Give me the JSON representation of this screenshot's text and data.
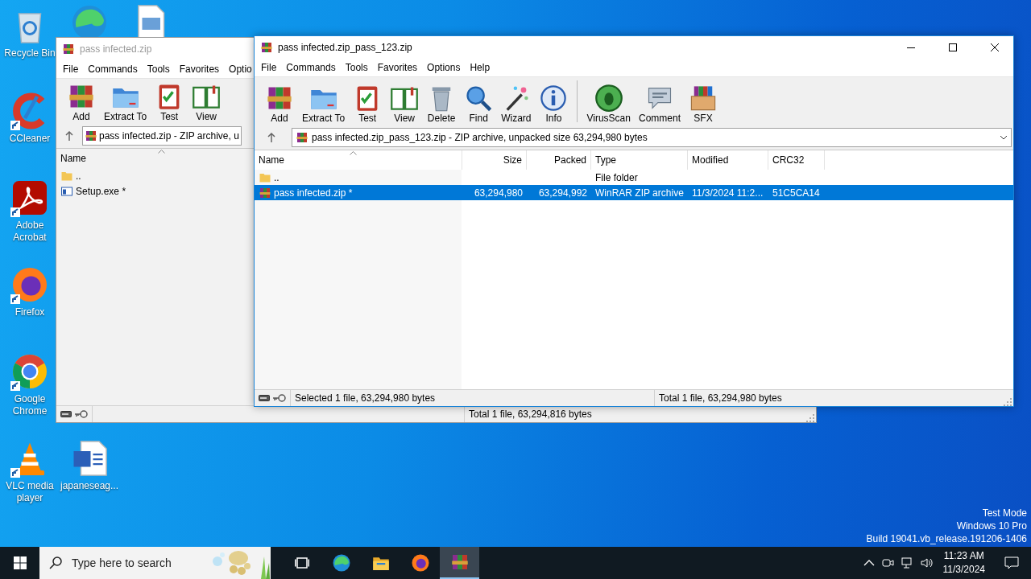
{
  "desktop_icons": [
    {
      "kind": "recycle",
      "label": "Recycle Bin",
      "shortcut": false
    },
    {
      "kind": "edge",
      "shortcut": false
    },
    {
      "kind": "image-file",
      "shortcut": false
    },
    {
      "kind": "ccleaner",
      "label": "CCleaner",
      "shortcut": true
    },
    {
      "kind": "acrobat",
      "label": "Adobe Acrobat",
      "shortcut": true
    },
    {
      "kind": "firefox",
      "label": "Firefox",
      "shortcut": true
    },
    {
      "kind": "chrome",
      "label": "Google Chrome",
      "shortcut": true
    },
    {
      "kind": "vlc",
      "label": "VLC media player",
      "shortcut": true
    },
    {
      "kind": "word",
      "label": "japaneseag...",
      "shortcut": false
    }
  ],
  "back_window": {
    "title": "pass infected.zip",
    "active": false,
    "menu": [
      "File",
      "Commands",
      "Tools",
      "Favorites",
      "Optio"
    ],
    "toolbar_groups": [
      [
        {
          "kind": "add",
          "label": "Add"
        },
        {
          "kind": "extract",
          "label": "Extract To"
        },
        {
          "kind": "test",
          "label": "Test"
        },
        {
          "kind": "view",
          "label": "View"
        }
      ]
    ],
    "address": "pass infected.zip - ZIP archive, u",
    "columns": [
      "Name"
    ],
    "rows": [
      {
        "kind": "up",
        "name": "..",
        "selected": false
      },
      {
        "kind": "exe",
        "name": "Setup.exe *",
        "selected": false
      }
    ],
    "status": [
      "Total 1 file, 63,294,816 bytes"
    ]
  },
  "front_window": {
    "title": "pass infected.zip_pass_123.zip",
    "active": true,
    "menu": [
      "File",
      "Commands",
      "Tools",
      "Favorites",
      "Options",
      "Help"
    ],
    "toolbar_groups": [
      [
        {
          "kind": "add",
          "label": "Add"
        },
        {
          "kind": "extract",
          "label": "Extract To"
        },
        {
          "kind": "test",
          "label": "Test"
        },
        {
          "kind": "view",
          "label": "View"
        },
        {
          "kind": "delete",
          "label": "Delete"
        },
        {
          "kind": "find",
          "label": "Find"
        },
        {
          "kind": "wizard",
          "label": "Wizard"
        },
        {
          "kind": "info",
          "label": "Info"
        }
      ],
      [
        {
          "kind": "virusscan",
          "label": "VirusScan"
        },
        {
          "kind": "comment",
          "label": "Comment"
        },
        {
          "kind": "sfx",
          "label": "SFX"
        }
      ]
    ],
    "address": "pass infected.zip_pass_123.zip - ZIP archive, unpacked size 63,294,980 bytes",
    "columns": [
      "Name",
      "Size",
      "Packed",
      "Type",
      "Modified",
      "CRC32"
    ],
    "rows": [
      {
        "kind": "up",
        "name": "..",
        "type": "File folder",
        "selected": false
      },
      {
        "kind": "archive",
        "name": "pass infected.zip *",
        "size": "63,294,980",
        "packed": "63,294,992",
        "type": "WinRAR ZIP archive",
        "modified": "11/3/2024 11:2...",
        "crc32": "51C5CA14",
        "selected": true
      }
    ],
    "status": [
      "Selected 1 file, 63,294,980 bytes",
      "Total 1 file, 63,294,980 bytes"
    ]
  },
  "system_overlay": [
    "Test Mode",
    "Windows 10 Pro",
    "Build 19041.vb_release.191206-1406"
  ],
  "taskbar": {
    "search_placeholder": "Type here to search",
    "apps": [
      {
        "kind": "task-view",
        "selected": false
      },
      {
        "kind": "edge",
        "selected": false
      },
      {
        "kind": "explorer",
        "selected": false
      },
      {
        "kind": "firefox",
        "selected": false
      },
      {
        "kind": "winrar",
        "selected": true
      }
    ],
    "time": "11:23 AM",
    "date": "11/3/2024"
  }
}
